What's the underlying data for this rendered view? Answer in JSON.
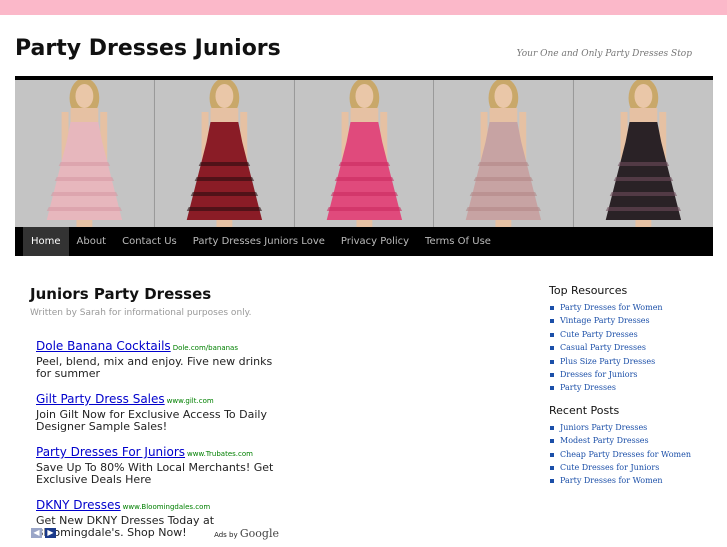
{
  "site": {
    "title": "Party Dresses Juniors",
    "tagline": "Your One and Only Party Dresses Stop"
  },
  "banner": {
    "dresses": [
      {
        "name": "pink-tiered-dress",
        "color": "#e7b7bd",
        "accent": "#d79aa3"
      },
      {
        "name": "red-plaid-dress",
        "color": "#8a1c26",
        "accent": "#2a0b0f"
      },
      {
        "name": "fuchsia-dress",
        "color": "#e04a7c",
        "accent": "#c92c60"
      },
      {
        "name": "mauve-dress",
        "color": "#c7a3a3",
        "accent": "#b28787"
      },
      {
        "name": "black-plaid-dress",
        "color": "#2a2226",
        "accent": "#6e4b5a"
      }
    ]
  },
  "nav": {
    "items": [
      "Home",
      "About",
      "Contact Us",
      "Party Dresses Juniors Love",
      "Privacy Policy",
      "Terms Of Use"
    ],
    "active": "Home"
  },
  "post": {
    "title": "Juniors Party Dresses",
    "byline": "Written by Sarah for informational purposes only."
  },
  "ads": {
    "items": [
      {
        "title": "Dole Banana Cocktails",
        "url": "Dole.com/bananas",
        "body": "Peel, blend, mix and enjoy. Five new drinks for summer"
      },
      {
        "title": "Gilt Party Dress Sales",
        "url": "www.gilt.com",
        "body": "Join Gilt Now for Exclusive Access To Daily Designer Sample Sales!"
      },
      {
        "title": "Party Dresses For Juniors",
        "url": "www.Trubates.com",
        "body": "Save Up To 80% With Local Merchants! Get Exclusive Deals Here"
      },
      {
        "title": "DKNY Dresses",
        "url": "www.Bloomingdales.com",
        "body": "Get New DKNY Dresses Today at Bloomingdale's. Shop Now!"
      }
    ],
    "prev_icon": "chevron-left-icon",
    "next_icon": "chevron-right-icon",
    "ads_by": "Ads by",
    "google": "Google"
  },
  "sidebar": {
    "top_resources": {
      "title": "Top Resources",
      "links": [
        "Party Dresses for Women",
        "Vintage Party Dresses",
        "Cute Party Dresses",
        "Casual Party Dresses",
        "Plus Size Party Dresses",
        "Dresses for Juniors",
        "Party Dresses"
      ]
    },
    "recent_posts": {
      "title": "Recent Posts",
      "links": [
        "Juniors Party Dresses",
        "Modest Party Dresses",
        "Cheap Party Dresses for Women",
        "Cute Dresses for Juniors",
        "Party Dresses for Women"
      ]
    }
  },
  "colors": {
    "topbar": "#fbb8c9",
    "nav_bg": "#000000",
    "link": "#0000cc",
    "sidebar_link": "#1b4fa8"
  }
}
